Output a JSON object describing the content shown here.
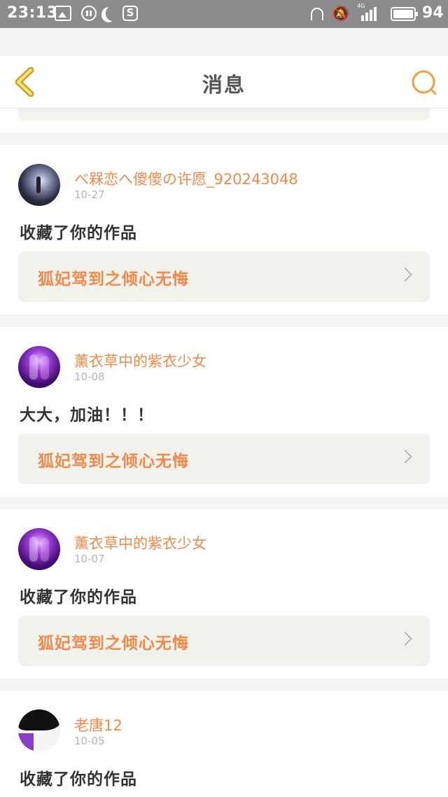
{
  "status_bar": {
    "time": "23:13",
    "battery": "94",
    "network": "4G",
    "icons": [
      "image-icon",
      "pause-icon",
      "moon-icon",
      "s-icon",
      "headset-icon",
      "mute-icon",
      "signal-icon",
      "battery-icon"
    ]
  },
  "header": {
    "title": "消息",
    "back_icon": "chevron-left-icon",
    "search_icon": "search-icon",
    "accent": "#f0a040"
  },
  "colors": {
    "username": "#f08a4b",
    "link_bg": "#f2f2ec",
    "date": "#b5b5b5"
  },
  "messages": [
    {
      "username": "べ槑恋へ傻傻の许愿_920243048",
      "date": "10-27",
      "message": "收藏了你的作品",
      "work_title": "狐妃驾到之倾心无悔",
      "avatar": "night-scene-avatar"
    },
    {
      "username": "薰衣草中的紫衣少女",
      "date": "10-08",
      "message": "大大，加油！！！",
      "work_title": "狐妃驾到之倾心无悔",
      "avatar": "purple-anime-avatar"
    },
    {
      "username": "薰衣草中的紫衣少女",
      "date": "10-07",
      "message": "收藏了你的作品",
      "work_title": "狐妃驾到之倾心无悔",
      "avatar": "purple-anime-avatar"
    },
    {
      "username": "老唐12",
      "date": "10-05",
      "message": "收藏了你的作品",
      "avatar": "dark-hair-avatar"
    }
  ]
}
